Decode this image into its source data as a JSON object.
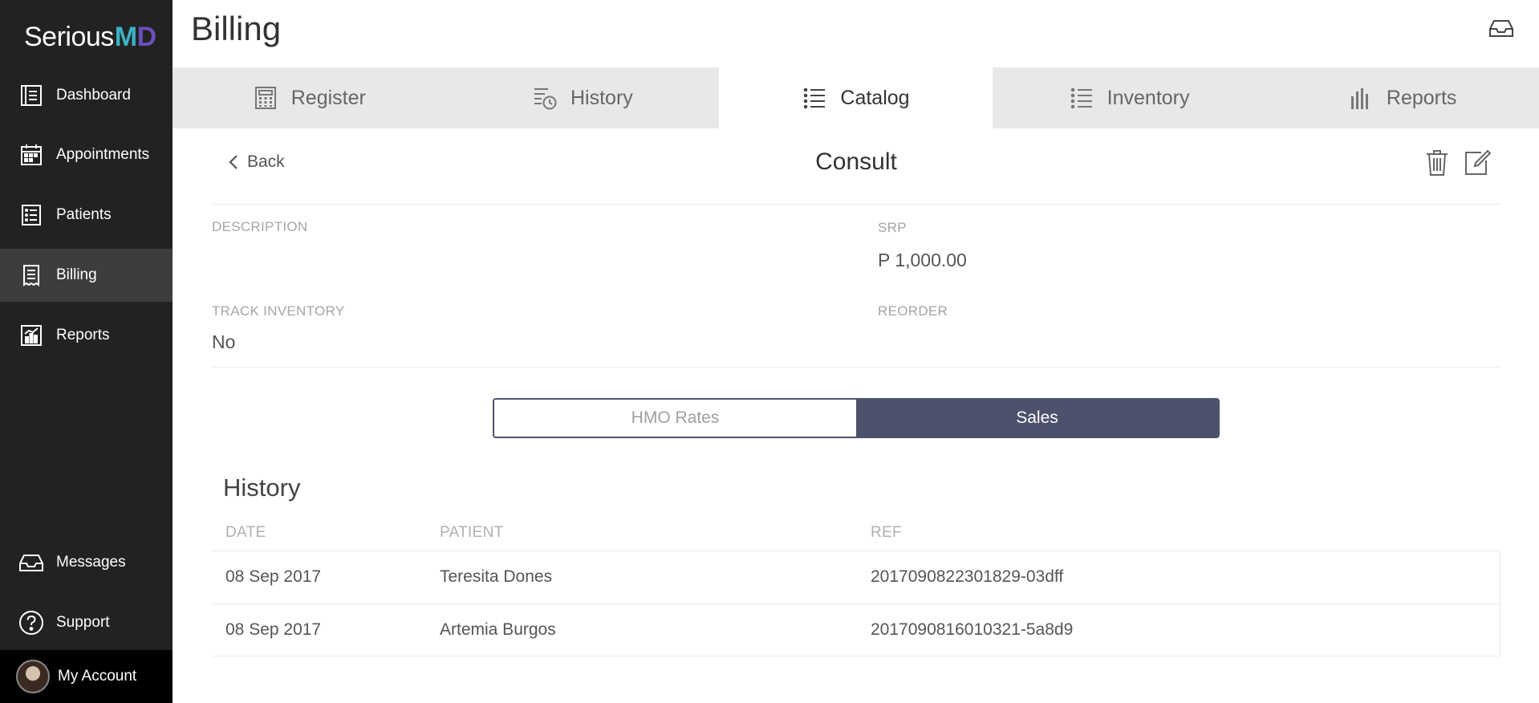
{
  "app": {
    "logo_main": "Serious",
    "logo_m": "M",
    "logo_d": "D"
  },
  "sidebar": {
    "items": [
      {
        "label": "Dashboard",
        "icon": "dashboard-icon"
      },
      {
        "label": "Appointments",
        "icon": "calendar-icon"
      },
      {
        "label": "Patients",
        "icon": "patients-list-icon"
      },
      {
        "label": "Billing",
        "icon": "receipt-icon",
        "active": true
      },
      {
        "label": "Reports",
        "icon": "chart-icon"
      }
    ],
    "bottom": [
      {
        "label": "Messages",
        "icon": "inbox-icon"
      },
      {
        "label": "Support",
        "icon": "question-icon"
      }
    ],
    "account_label": "My Account"
  },
  "header": {
    "title": "Billing",
    "icon": "inbox-icon"
  },
  "tabs": [
    {
      "label": "Register",
      "icon": "calculator-icon"
    },
    {
      "label": "History",
      "icon": "history-clock-icon"
    },
    {
      "label": "Catalog",
      "icon": "list-icon",
      "active": true
    },
    {
      "label": "Inventory",
      "icon": "list-icon"
    },
    {
      "label": "Reports",
      "icon": "bar-chart-icon"
    }
  ],
  "item": {
    "back_label": "Back",
    "title": "Consult",
    "description_label": "DESCRIPTION",
    "description_value": "",
    "srp_label": "SRP",
    "srp_value": "P 1,000.00",
    "track_inventory_label": "TRACK INVENTORY",
    "track_inventory_value": "No",
    "reorder_label": "REORDER",
    "reorder_value": ""
  },
  "toggle": {
    "left": "HMO Rates",
    "right": "Sales",
    "selected": "Sales"
  },
  "history": {
    "title": "History",
    "columns": [
      "DATE",
      "PATIENT",
      "REF"
    ],
    "rows": [
      {
        "date": "08 Sep 2017",
        "patient": "Teresita Dones",
        "ref": "2017090822301829-03dff"
      },
      {
        "date": "08 Sep 2017",
        "patient": "Artemia Burgos",
        "ref": "2017090816010321-5a8d9"
      }
    ]
  },
  "colors": {
    "sidebar_bg": "#222222",
    "accent": "#4d526c",
    "logo_m": "#3bb3c3",
    "logo_d": "#6b4fbb"
  }
}
